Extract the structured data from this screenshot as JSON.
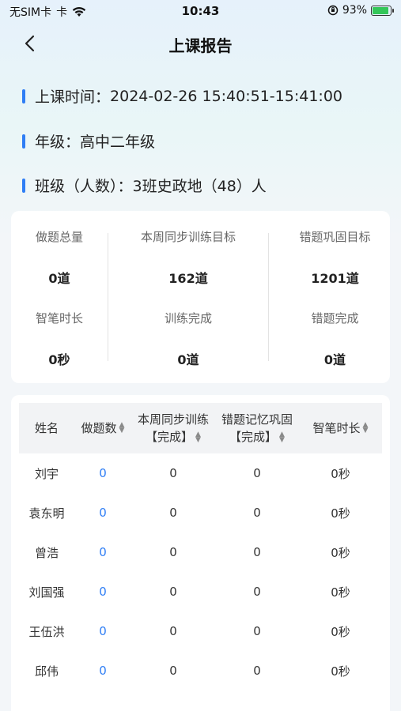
{
  "status_bar": {
    "carrier": "无SIM卡",
    "time": "10:43",
    "battery": "93%",
    "battery_level": 0.93,
    "icons": [
      "wifi-icon",
      "orientation-lock-icon",
      "battery-icon"
    ]
  },
  "nav": {
    "title": "上课报告",
    "back_icon": "chevron-left-icon"
  },
  "info": {
    "time_label": "上课时间：",
    "time_value": "2024-02-26 15:40:51-15:41:00",
    "grade_label": "年级：",
    "grade_value": "高中二年级",
    "class_label": "班级（人数）：",
    "class_value": "3班史政地（48）人"
  },
  "stats": [
    {
      "label_top": "做题总量",
      "value_top": "0道",
      "label_bottom": "智笔时长",
      "value_bottom": "0秒"
    },
    {
      "label_top": "本周同步训练目标",
      "value_top": "162道",
      "label_bottom": "训练完成",
      "value_bottom": "0道"
    },
    {
      "label_top": "错题巩固目标",
      "value_top": "1201道",
      "label_bottom": "错题完成",
      "value_bottom": "0道"
    }
  ],
  "table": {
    "headers": {
      "name": "姓名",
      "count": "做题数",
      "sync_line1": "本周同步训练",
      "sync_line2": "【完成】",
      "memory_line1": "错题记忆巩固",
      "memory_line2": "【完成】",
      "pen_time": "智笔时长"
    },
    "rows": [
      {
        "name": "刘宇",
        "count": "0",
        "sync": "0",
        "memory": "0",
        "pen_time": "0秒"
      },
      {
        "name": "袁东明",
        "count": "0",
        "sync": "0",
        "memory": "0",
        "pen_time": "0秒"
      },
      {
        "name": "曾浩",
        "count": "0",
        "sync": "0",
        "memory": "0",
        "pen_time": "0秒"
      },
      {
        "name": "刘国强",
        "count": "0",
        "sync": "0",
        "memory": "0",
        "pen_time": "0秒"
      },
      {
        "name": "王伍洪",
        "count": "0",
        "sync": "0",
        "memory": "0",
        "pen_time": "0秒"
      },
      {
        "name": "邱伟",
        "count": "0",
        "sync": "0",
        "memory": "0",
        "pen_time": "0秒"
      }
    ]
  },
  "colors": {
    "accent": "#2f7ef5",
    "battery_green": "#34c759",
    "background_top": "#e6f1fb",
    "card": "#ffffff",
    "table_header": "#f2f3f5"
  }
}
